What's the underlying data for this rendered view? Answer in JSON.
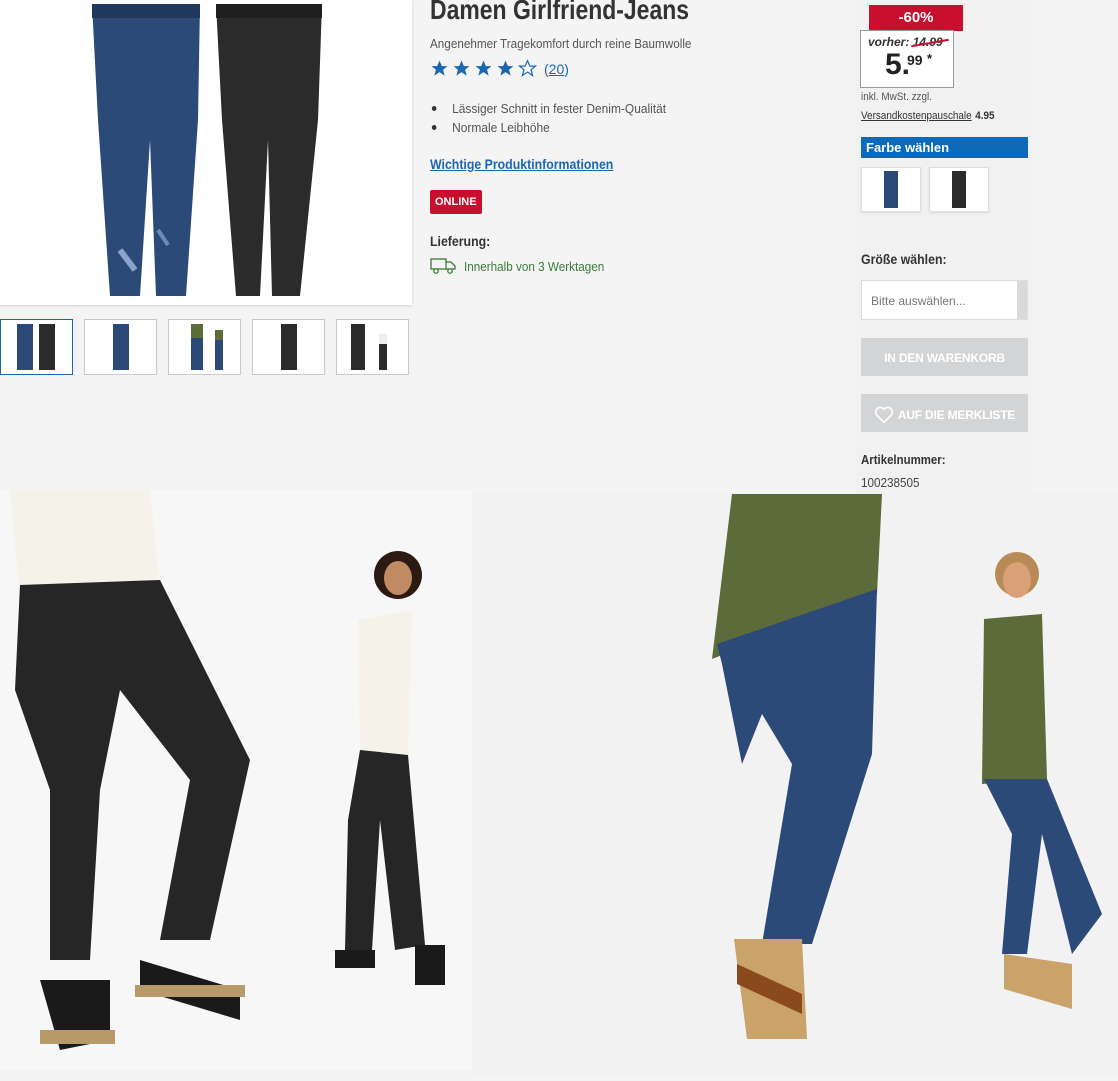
{
  "product": {
    "title": "Damen Girlfriend-Jeans",
    "subtitle": "Angenehmer Tragekomfort durch reine Baumwolle",
    "rating": {
      "stars": 4,
      "max": 5,
      "count_label": "20"
    },
    "features": [
      "Lässiger Schnitt in fester Denim-Qualität",
      "Normale Leibhöhe"
    ],
    "info_link": "Wichtige Produktinformationen",
    "badge": "ONLINE",
    "delivery_label": "Lieferung:",
    "delivery_text": "Innerhalb von 3 Werktagen"
  },
  "gallery": {
    "thumbnails": [
      "both-jeans",
      "blue-jeans",
      "model-blue",
      "black-jeans",
      "model-black"
    ],
    "active_index": 0
  },
  "purchase": {
    "discount": "-60%",
    "old_price_label": "vorher:",
    "old_price": "14.99",
    "price_int": "5.",
    "price_dec": "99",
    "price_mark": "*",
    "vat_text": "inkl. MwSt. zzgl.",
    "shipping_link": "Versandkostenpauschale",
    "shipping_amount": "4.95",
    "color_header": "Farbe wählen",
    "colors": [
      "blue",
      "black"
    ],
    "size_label": "Größe wählen:",
    "size_placeholder": "Bitte auswählen...",
    "cart_button": "IN DEN WARENKORB",
    "wishlist_button": "AUF DIE MERKLISTE",
    "article_label": "Artikelnummer:",
    "article_number": "100238505"
  },
  "colors": {
    "brand_blue": "#0d6ab8",
    "sale_red": "#c8102e",
    "button_grey": "#d3d4d6",
    "delivery_green": "#3a7a3a"
  }
}
